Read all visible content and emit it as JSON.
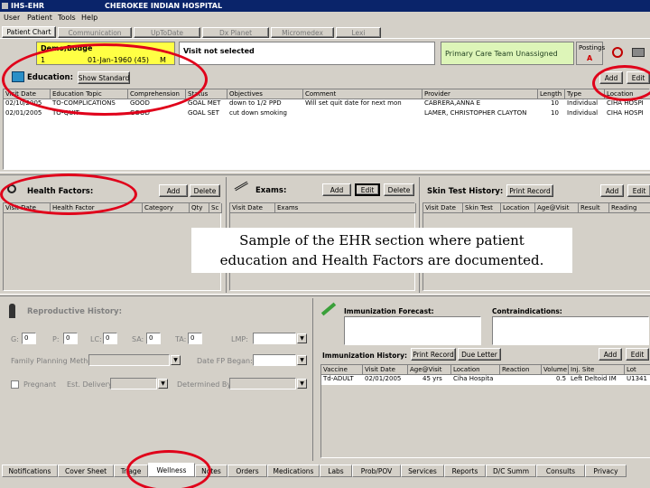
{
  "window": {
    "title": "CHEROKEE INDIAN HOSPITAL",
    "app": "IHS-EHR"
  },
  "menu": [
    "User",
    "Patient",
    "Tools",
    "Help"
  ],
  "top_tabs": [
    "Patient Chart",
    "Communication",
    "UpToDate",
    "Dx Planet",
    "Micromedex",
    "Lexi"
  ],
  "patient": {
    "name": "Demo,Bodge",
    "id": "1",
    "dob": "01-Jan-1960 (45)",
    "sex": "M"
  },
  "visit": {
    "label": "Visit not selected"
  },
  "care_team": {
    "label": "Primary Care Team Unassigned"
  },
  "postings": {
    "label": "Postings",
    "value": "A"
  },
  "education": {
    "title": "Education:",
    "show_button": "Show Standard",
    "add": "Add",
    "edit": "Edit",
    "columns": [
      "Visit Date",
      "Education Topic",
      "Comprehension",
      "Status",
      "Objectives",
      "Comment",
      "Provider",
      "Length",
      "Type",
      "Location"
    ],
    "rows": [
      [
        "02/10/2005",
        "TO-COMPLICATIONS",
        "GOOD",
        "GOAL MET",
        "down to 1/2 PPD",
        "Will set quit date for next mon",
        "CABRERA,ANNA E",
        "10",
        "Individual",
        "CIHA HOSPI"
      ],
      [
        "02/01/2005",
        "TO-QUIT",
        "GOOD",
        "GOAL SET",
        "cut down smoking",
        "",
        "LAMER, CHRISTOPHER CLAYTON",
        "10",
        "Individual",
        "CIHA HOSPI"
      ]
    ]
  },
  "health_factors": {
    "title": "Health Factors:",
    "add": "Add",
    "delete": "Delete",
    "columns": [
      "Visit Date",
      "Health Factor",
      "Category",
      "Qty",
      "Sc"
    ]
  },
  "exams": {
    "title": "Exams:",
    "add": "Add",
    "edit": "Edit",
    "delete": "Delete",
    "columns": [
      "Visit Date",
      "Exams"
    ]
  },
  "skin_test": {
    "title": "Skin Test History:",
    "print": "Print Record",
    "add": "Add",
    "edit": "Edit",
    "columns": [
      "Visit Date",
      "Skin Test",
      "Location",
      "Age@Visit",
      "Result",
      "Reading"
    ]
  },
  "caption": {
    "line1": "Sample of the EHR section where patient",
    "line2": "education and Health Factors are documented."
  },
  "reproductive": {
    "title": "Reproductive History:",
    "g_label": "G:",
    "g_val": "0",
    "p_label": "P:",
    "p_val": "0",
    "lc_label": "LC:",
    "lc_val": "0",
    "sa_label": "SA:",
    "sa_val": "0",
    "ta_label": "TA:",
    "ta_val": "0",
    "lmp_label": "LMP:",
    "family_planning_label": "Family Planning Method:",
    "date_fp_label": "Date FP Began:",
    "pregnant_label": "Pregnant",
    "edd_label": "Est. Delivery:",
    "determined_label": "Determined By:"
  },
  "immunization": {
    "forecast_title": "Immunization Forecast:",
    "contra_title": "Contraindications:",
    "history_title": "Immunization History:",
    "print": "Print Record",
    "due_letter": "Due Letter",
    "add": "Add",
    "edit": "Edit",
    "columns": [
      "Vaccine",
      "Visit Date",
      "Age@Visit",
      "Location",
      "Reaction",
      "Volume",
      "Inj. Site",
      "Lot"
    ],
    "rows": [
      [
        "Td-ADULT",
        "02/01/2005",
        "45 yrs",
        "Ciha Hospita",
        "",
        "0.5",
        "Left Deltoid IM",
        "U1341"
      ]
    ]
  },
  "bottom_tabs": [
    "Notifications",
    "Cover Sheet",
    "Triage",
    "Wellness",
    "Notes",
    "Orders",
    "Medications",
    "Labs",
    "Prob/POV",
    "Services",
    "Reports",
    "D/C Summ",
    "Consults",
    "Privacy"
  ]
}
